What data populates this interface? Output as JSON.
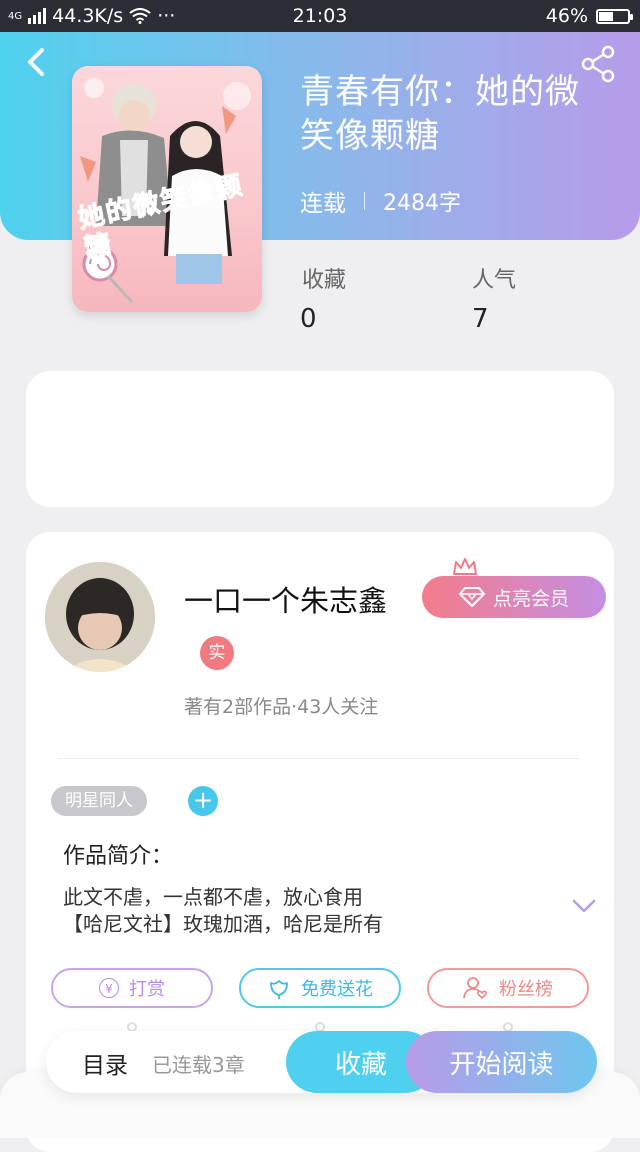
{
  "status_bar": {
    "network": "4G",
    "speed": "44.3K/s",
    "more": "···",
    "time": "21:03",
    "battery": "46%"
  },
  "book": {
    "title": "青春有你：她的微笑像颗糖",
    "status": "连载",
    "word_count": "2484字",
    "cover_caption": "她的微笑像颗糖",
    "stats": {
      "favorites_label": "收藏",
      "favorites_value": "0",
      "popularity_label": "人气",
      "popularity_value": "7"
    }
  },
  "author": {
    "name": "一口一个朱志鑫",
    "badge": "实",
    "stats": "著有2部作品·43人关注",
    "vip_button": "点亮会员"
  },
  "tags": {
    "items": [
      "明星同人"
    ],
    "add": "+"
  },
  "intro": {
    "label": "作品简介：",
    "text_line1": "此文不虐，一点都不虐，放心食用",
    "text_line2": "【哈尼文社】玫瑰加酒，哈尼是所有"
  },
  "actions": {
    "reward": "打赏",
    "flower": "免费送花",
    "fans": "粉丝榜",
    "reward_symbol": "¥"
  },
  "bottom": {
    "toc": "目录",
    "chapters": "已连载3章",
    "favorite": "收藏",
    "read": "开始阅读"
  },
  "colors": {
    "header_start": "#4fd2ee",
    "header_end": "#b79ce9",
    "accent_blue": "#4fd0ee",
    "accent_purple": "#b89be9",
    "badge_pink": "#f07a80"
  }
}
